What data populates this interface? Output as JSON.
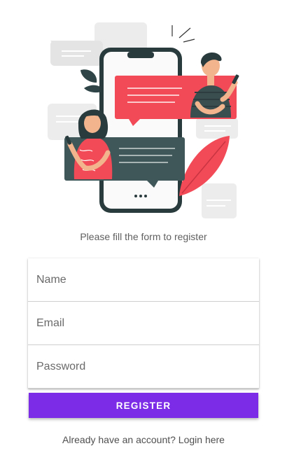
{
  "subtitle": "Please fill the form to register",
  "form": {
    "name_placeholder": "Name",
    "email_placeholder": "Email",
    "password_placeholder": "Password"
  },
  "register_label": "REGISTER",
  "login_text": "Already have an account? Login here",
  "colors": {
    "accent": "#7c2be6",
    "bubble_red": "#f24a56",
    "bubble_dark": "#3f5759"
  }
}
